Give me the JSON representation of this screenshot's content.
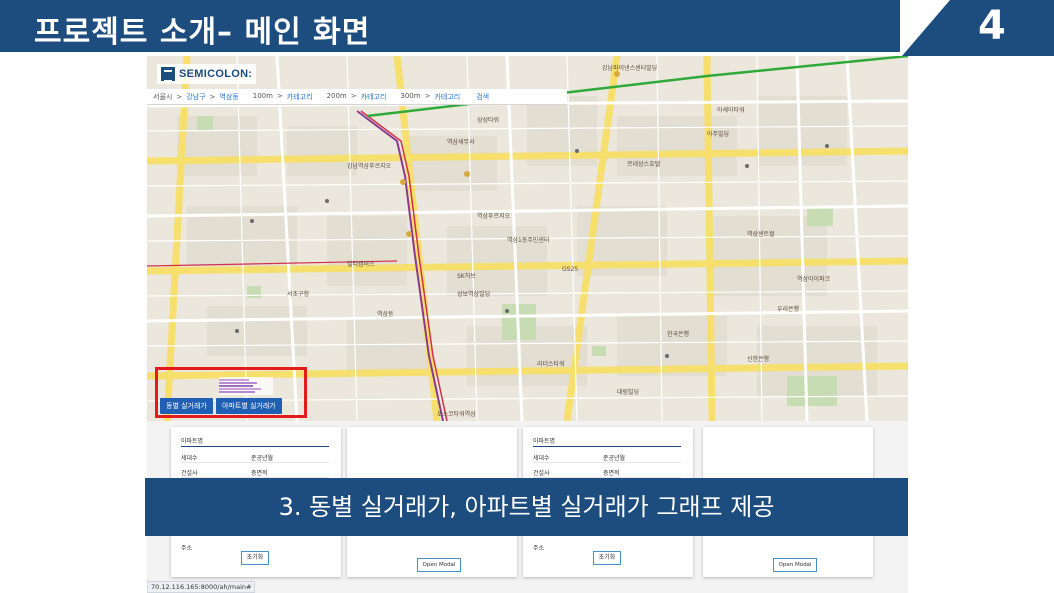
{
  "header": {
    "title": "프로젝트 소개– 메인 화면",
    "slide_number": "4"
  },
  "caption": "3. 동별 실거래가, 아파트별 실거래가 그래프 제공",
  "app": {
    "logo_text": "SEMICOLON:",
    "breadcrumb": [
      "서울시",
      ">",
      "강남구",
      ">",
      "역삼동"
    ],
    "radius_filters": [
      {
        "label": "100m",
        "sep": ">",
        "value": "카테고리"
      },
      {
        "label": "200m",
        "sep": ">",
        "value": "카테고리"
      },
      {
        "label": "300m",
        "sep": ">",
        "value": "카테고리"
      }
    ],
    "search_label": "검색",
    "chart_buttons": {
      "dong": "동별 실거래가",
      "apartment": "아파트별 실거래가"
    },
    "cards": [
      {
        "title": "아파트명",
        "rows": [
          {
            "key": "세대수",
            "value": "준공년월"
          },
          {
            "key": "건설사",
            "value": "층면적"
          }
        ],
        "footer": "주소",
        "button": "초기화"
      },
      {
        "button": "Open Modal"
      },
      {
        "title": "아파트명",
        "rows": [
          {
            "key": "세대수",
            "value": "준공년월"
          },
          {
            "key": "건설사",
            "value": "층면적"
          }
        ],
        "footer": "주소",
        "button": "초기화"
      },
      {
        "button": "Open Modal"
      }
    ],
    "status_url": "70.12.116.165:8000/ah/main#"
  },
  "map_labels": [
    "강남파이낸스센터빌딩",
    "역삼세무서",
    "아주빌딩",
    "GS25",
    "강남역삼푸르지오",
    "역삼1동주민센터",
    "한국은행",
    "성보역삼빌딩",
    "삼성타워",
    "서초구청",
    "역삼푸르지오",
    "리더스타워",
    "역삼동",
    "역삼센트럴",
    "대림빌딩",
    "삼원빌딩",
    "르네상스호텔",
    "우리은행",
    "신한은행",
    "멀티캠퍼스",
    "SK허브",
    "역삼아이파크",
    "아세아타워",
    "포스코타워역삼"
  ],
  "colors": {
    "header_blue": "#1d4d7e",
    "highlight_red": "#e41b1b",
    "button_blue": "#1f5fb4",
    "subway_green": "#2faa3a"
  }
}
